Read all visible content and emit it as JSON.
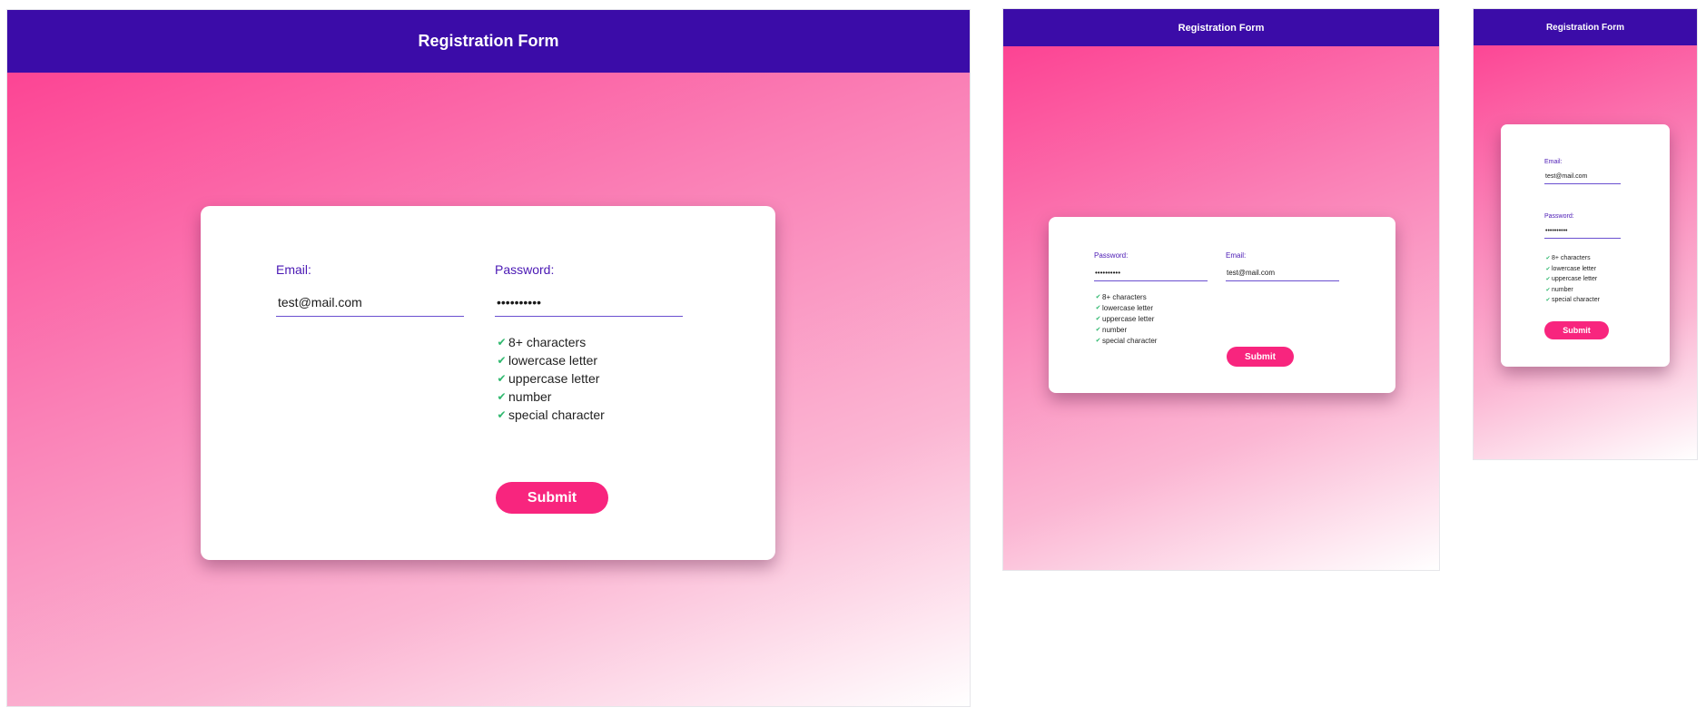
{
  "header": {
    "title": "Registration Form"
  },
  "form": {
    "email_label": "Email:",
    "email_value": "test@mail.com",
    "password_label": "Password:",
    "password_value": "••••••••••",
    "submit_label": "Submit",
    "rules": [
      "8+ characters",
      "lowercase letter",
      "uppercase letter",
      "number",
      "special character"
    ],
    "check_glyph": "✔"
  },
  "colors": {
    "header_bg": "#3b0ca8",
    "gradient_start": "#fd3a8e",
    "gradient_end": "#ffffff",
    "label": "#4a18b4",
    "check": "#2fb86e",
    "submit_bg": "#f8257e"
  }
}
